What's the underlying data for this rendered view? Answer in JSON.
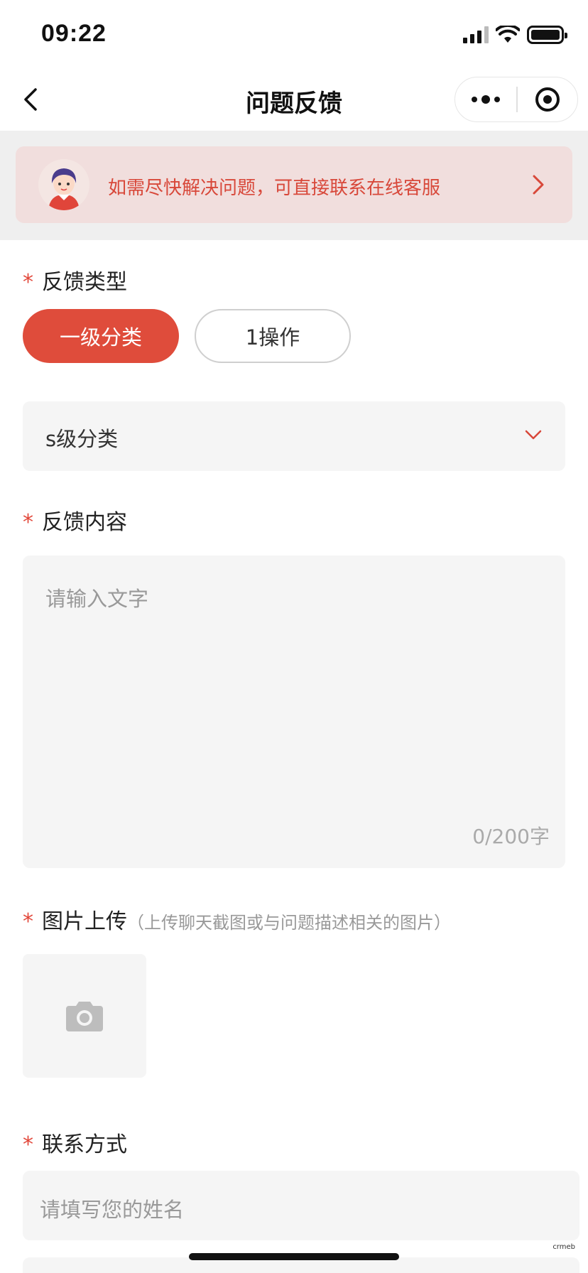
{
  "status_bar": {
    "time": "09:22",
    "icons": [
      "cellular-signal-icon",
      "wifi-icon",
      "battery-icon"
    ]
  },
  "nav": {
    "title": "问题反馈",
    "back_icon": "chevron-left-icon",
    "more_icon": "more-dots-icon",
    "close_icon": "target-circle-icon"
  },
  "banner": {
    "text": "如需尽快解决问题，可直接联系在线客服",
    "avatar_icon": "customer-service-avatar",
    "arrow_icon": "chevron-right-icon"
  },
  "form": {
    "feedback_type": {
      "label": "反馈类型",
      "required_mark": "*",
      "chips": [
        {
          "label": "一级分类",
          "selected": true
        },
        {
          "label": "1操作",
          "selected": false
        }
      ],
      "sub_select": {
        "value": "s级分类",
        "icon": "chevron-down-icon"
      }
    },
    "content": {
      "label": "反馈内容",
      "required_mark": "*",
      "placeholder": "请输入文字",
      "counter": "0/200字"
    },
    "image_upload": {
      "label": "图片上传",
      "required_mark": "*",
      "hint": "（上传聊天截图或与问题描述相关的图片）",
      "icon": "camera-icon"
    },
    "contact": {
      "label": "联系方式",
      "required_mark": "*",
      "name_placeholder": "请填写您的姓名"
    }
  },
  "watermark": "crmeb",
  "colors": {
    "accent": "#df4c3b",
    "banner_bg": "#f1dedd",
    "field_bg": "#f5f5f5"
  }
}
